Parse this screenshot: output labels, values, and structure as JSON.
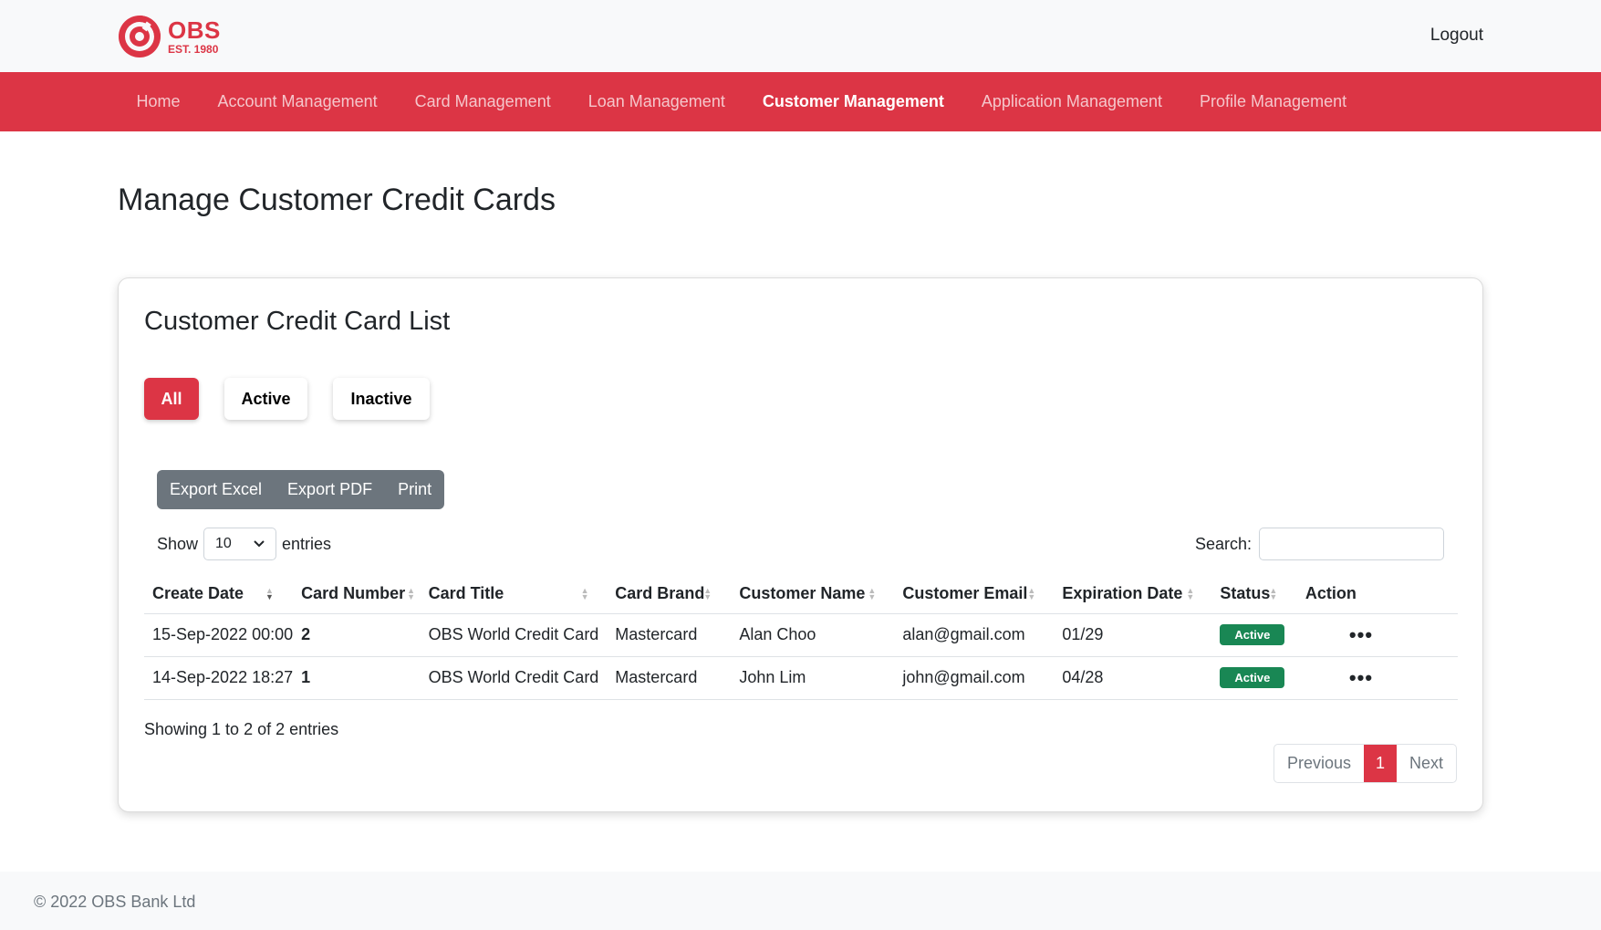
{
  "brand": {
    "name": "OBS",
    "est": "EST. 1980",
    "color": "#dc3545"
  },
  "header": {
    "logout_label": "Logout"
  },
  "nav": {
    "items": [
      {
        "label": "Home",
        "active": false
      },
      {
        "label": "Account Management",
        "active": false
      },
      {
        "label": "Card Management",
        "active": false
      },
      {
        "label": "Loan Management",
        "active": false
      },
      {
        "label": "Customer Management",
        "active": true
      },
      {
        "label": "Application Management",
        "active": false
      },
      {
        "label": "Profile Management",
        "active": false
      }
    ]
  },
  "page": {
    "title": "Manage Customer Credit Cards"
  },
  "card": {
    "title": "Customer Credit Card List",
    "filters": {
      "all": "All",
      "active": "Active",
      "inactive": "Inactive",
      "selected": "All"
    },
    "exports": {
      "excel": "Export Excel",
      "pdf": "Export PDF",
      "print": "Print"
    },
    "length": {
      "show": "Show",
      "value": "10",
      "entries": "entries"
    },
    "search": {
      "label": "Search:",
      "value": "",
      "placeholder": ""
    }
  },
  "table": {
    "columns": [
      "Create Date",
      "Card Number",
      "Card Title",
      "Card Brand",
      "Customer Name",
      "Customer Email",
      "Expiration Date",
      "Status",
      "Action"
    ],
    "rows": [
      {
        "create_date": "15-Sep-2022 00:00",
        "card_number": "2",
        "card_title": "OBS World Credit Card",
        "card_brand": "Mastercard",
        "customer_name": "Alan Choo",
        "customer_email": "alan@gmail.com",
        "expiration_date": "01/29",
        "status": "Active",
        "action": "•••"
      },
      {
        "create_date": "14-Sep-2022 18:27",
        "card_number": "1",
        "card_title": "OBS World Credit Card",
        "card_brand": "Mastercard",
        "customer_name": "John Lim",
        "customer_email": "john@gmail.com",
        "expiration_date": "04/28",
        "status": "Active",
        "action": "•••"
      }
    ],
    "status_color": "#198754"
  },
  "pagination": {
    "info": "Showing 1 to 2 of 2 entries",
    "previous": "Previous",
    "current": "1",
    "next": "Next"
  },
  "footer": {
    "text": "© 2022 OBS Bank Ltd"
  }
}
